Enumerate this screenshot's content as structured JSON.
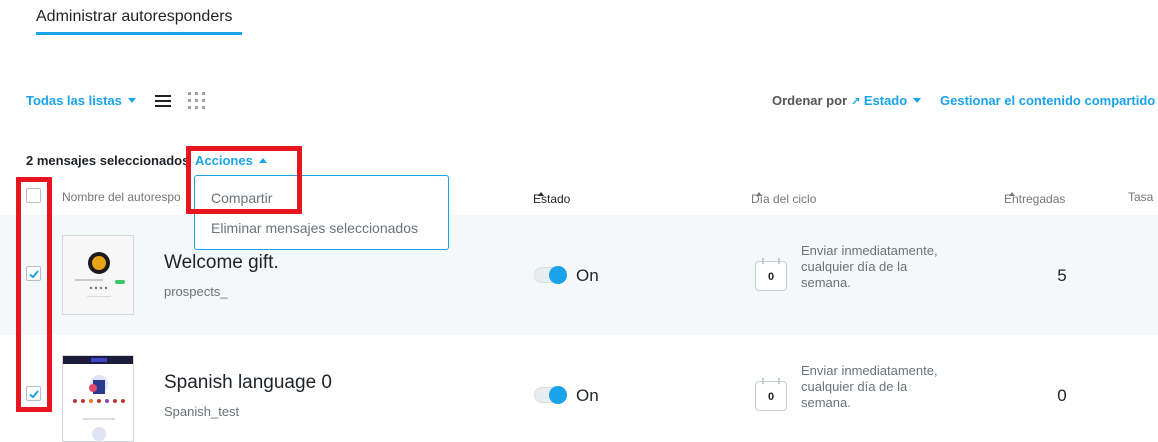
{
  "tabs": {
    "active": "Administrar autoresponders"
  },
  "toolbar": {
    "list_filter": "Todas las listas",
    "sort_label": "Ordenar por",
    "sort_value": "Estado",
    "manage_shared": "Gestionar el contenido compartido"
  },
  "selection": {
    "count_text": "2 mensajes seleccionados",
    "actions_label": "Acciones"
  },
  "actions_menu": {
    "items": [
      "Compartir",
      "Eliminar mensajes seleccionados"
    ]
  },
  "table": {
    "columns": [
      "Nombre del autorespo",
      "Estado",
      "Día del ciclo",
      "Entregadas",
      "Tasa"
    ],
    "rows": [
      {
        "title": "Welcome gift.",
        "list": "prospects_",
        "status": "On",
        "cycle_day": "0",
        "cycle_text": "Enviar inmediatamente, cualquier día de la semana.",
        "delivered": "5",
        "checked": true
      },
      {
        "title": "Spanish language 0",
        "list": "Spanish_test",
        "status": "On",
        "cycle_day": "0",
        "cycle_text": "Enviar inmediatamente, cualquier día de la semana.",
        "delivered": "0",
        "checked": true
      }
    ]
  },
  "colors": {
    "accent": "#1aa3e8",
    "highlight": "#e8141f",
    "row_alt": "#f4f8f9"
  }
}
